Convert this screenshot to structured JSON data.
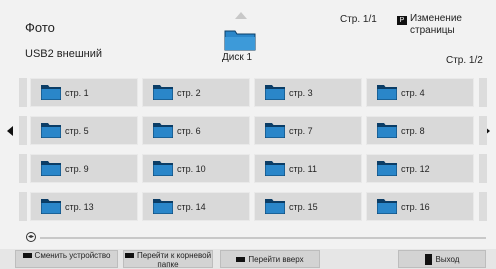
{
  "header": {
    "title": "Фото",
    "device": "USB2 внешний",
    "disk_label": "Диск 1",
    "page_count": "Стр. 1/1",
    "pg_badge": "P",
    "page_change_label": "Изменение страницы",
    "page_indicator": "Стр. 1/2"
  },
  "folders": [
    {
      "label": "стр. 1"
    },
    {
      "label": "стр. 2"
    },
    {
      "label": "стр. 3"
    },
    {
      "label": "стр. 4"
    },
    {
      "label": "стр. 5"
    },
    {
      "label": "стр. 6"
    },
    {
      "label": "стр. 7"
    },
    {
      "label": "стр. 8"
    },
    {
      "label": "стр. 9"
    },
    {
      "label": "стр. 10"
    },
    {
      "label": "стр. 11"
    },
    {
      "label": "стр. 12"
    },
    {
      "label": "стр. 13"
    },
    {
      "label": "стр. 14"
    },
    {
      "label": "стр. 15"
    },
    {
      "label": "стр. 16"
    }
  ],
  "footer": {
    "change_device": "Сменить устройство",
    "go_root": "Перейти к корневой папке",
    "go_up": "Перейти вверх",
    "exit": "Выход"
  },
  "icons": {
    "folder": "folder-icon",
    "nav_left": "arrow-left-icon",
    "nav_right": "arrow-right-icon",
    "scroll": "scroll-icon"
  },
  "colors": {
    "folder_blue": "#2a86c9",
    "folder_dark": "#0b3d66",
    "tile_bg": "#d9d9d9",
    "page_bg": "#f2f2f2"
  }
}
